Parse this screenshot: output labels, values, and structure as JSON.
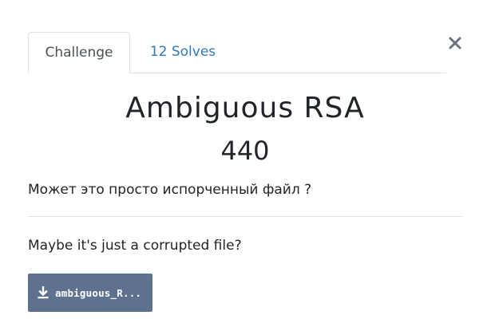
{
  "modal": {
    "tabs": [
      {
        "label": "Challenge",
        "active": true
      },
      {
        "label": "12 Solves",
        "active": false
      }
    ]
  },
  "challenge": {
    "name": "Ambiguous RSA",
    "points": "440",
    "description_ru": "Может это просто испорченный файл ?",
    "description_en": "Maybe it's just a corrupted file?",
    "file_label": "ambiguous_R..."
  },
  "colors": {
    "link": "#337ab7",
    "file_button_bg": "#5e7290",
    "border": "#dee2e6"
  },
  "icons": {
    "close": "close-icon",
    "download": "download-icon"
  }
}
